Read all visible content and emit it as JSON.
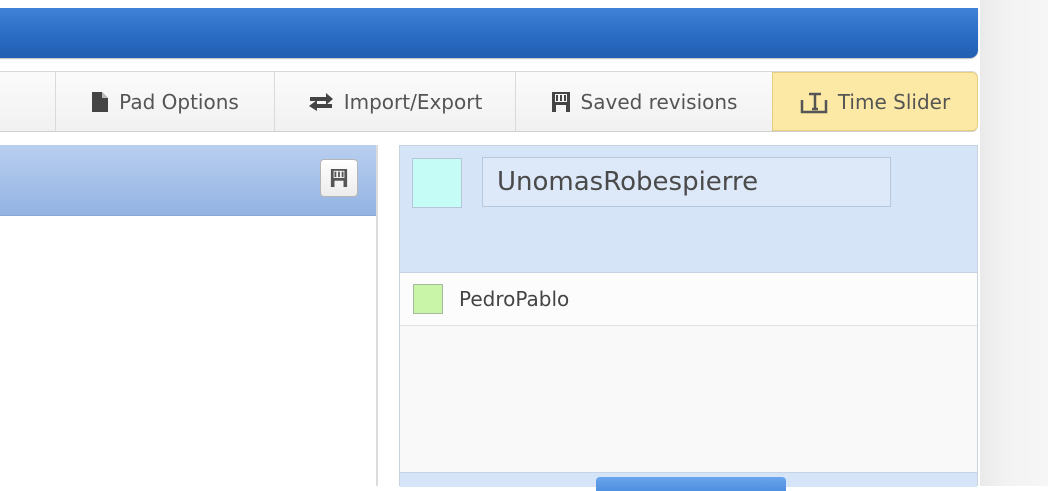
{
  "toolbar": {
    "pad_options_label": "Pad Options",
    "import_export_label": "Import/Export",
    "saved_revisions_label": "Saved revisions",
    "time_slider_label": "Time Slider"
  },
  "users": {
    "my_name": "UnomasRobespierre",
    "my_color": "#c6fcf6",
    "list": [
      {
        "name": "PedroPablo",
        "color": "#c8f5a8"
      }
    ]
  },
  "icons": {
    "pad_options": "document-icon",
    "import_export": "swap-arrows-icon",
    "saved_revisions": "save-icon",
    "time_slider": "time-slider-icon",
    "editor_save": "save-icon"
  },
  "colors": {
    "titlebar": "#2a6cc5",
    "active_tab": "#fde9a6",
    "panel_header": "#d6e4f7"
  }
}
